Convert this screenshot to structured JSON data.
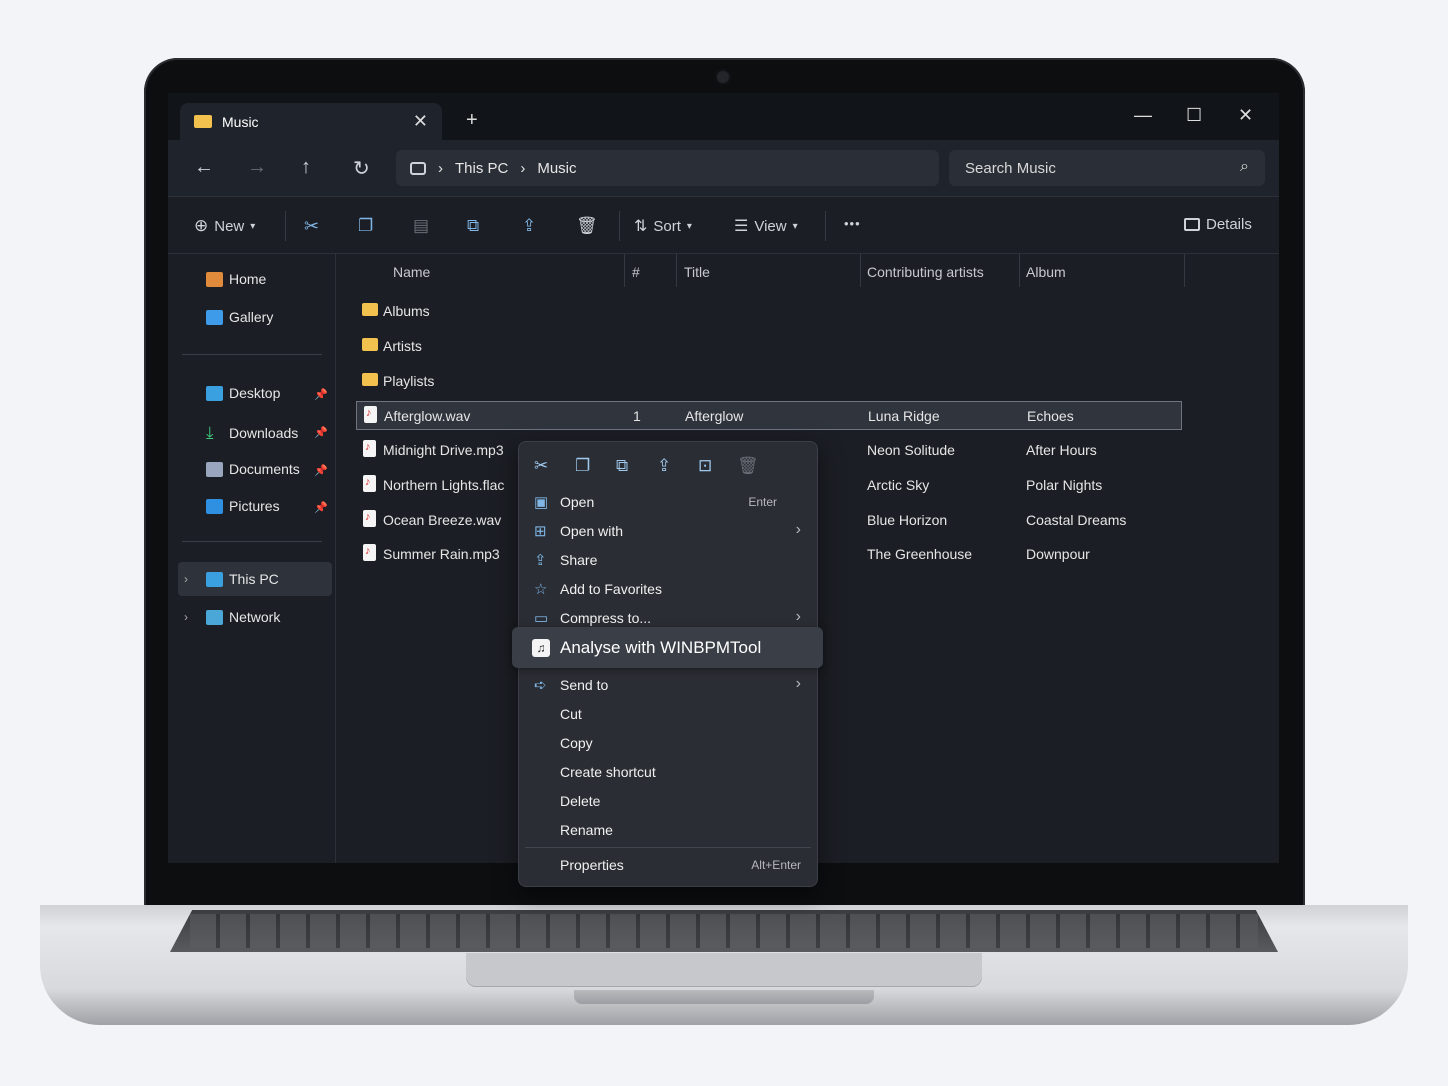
{
  "window": {
    "tab_title": "Music",
    "tab_close": "✕",
    "new_tab": "+",
    "minimize": "—",
    "maximize": "☐",
    "close": "✕"
  },
  "nav": {
    "back": "←",
    "forward": "→",
    "up": "↑",
    "refresh": "↻",
    "breadcrumb": [
      "This PC",
      "Music"
    ],
    "separator": "›",
    "search_placeholder": "Search Music"
  },
  "toolbar": {
    "new_label": "New",
    "sort_label": "Sort",
    "view_label": "View",
    "more_label": "•••",
    "details_label": "Details"
  },
  "sidebar": {
    "home": "Home",
    "gallery": "Gallery",
    "desktop": "Desktop",
    "downloads": "Downloads",
    "documents": "Documents",
    "pictures": "Pictures",
    "this_pc": "This PC",
    "network": "Network"
  },
  "columns": {
    "name": "Name",
    "number": "#",
    "title": "Title",
    "artists": "Contributing artists",
    "album": "Album"
  },
  "folders": [
    "Albums",
    "Artists",
    "Playlists"
  ],
  "files": [
    {
      "name": "Afterglow.wav",
      "number": "1",
      "title": "Afterglow",
      "artist": "Luna Ridge",
      "album": "Echoes"
    },
    {
      "name": "Midnight Drive.mp3",
      "number": "",
      "title": "",
      "artist": "Neon Solitude",
      "album": "After Hours"
    },
    {
      "name": "Northern Lights.flac",
      "number": "",
      "title": "",
      "artist": "Arctic Sky",
      "album": "Polar Nights"
    },
    {
      "name": "Ocean Breeze.wav",
      "number": "",
      "title": "",
      "artist": "Blue Horizon",
      "album": "Coastal Dreams"
    },
    {
      "name": "Summer Rain.mp3",
      "number": "",
      "title": "",
      "artist": "The Greenhouse",
      "album": "Downpour"
    }
  ],
  "context_menu": {
    "open": "Open",
    "open_shortcut": "Enter",
    "open_with": "Open with",
    "share": "Share",
    "add_favorites": "Add to Favorites",
    "compress": "Compress to...",
    "analyse": "Analyse with WINBPMTool",
    "send_to": "Send to",
    "cut": "Cut",
    "copy": "Copy",
    "create_shortcut": "Create shortcut",
    "delete": "Delete",
    "rename": "Rename",
    "properties": "Properties",
    "properties_shortcut": "Alt+Enter",
    "arrow": "›"
  },
  "colors": {
    "accent": "#7fb6e6",
    "folder": "#f2c14e",
    "background": "#1b1e24"
  }
}
